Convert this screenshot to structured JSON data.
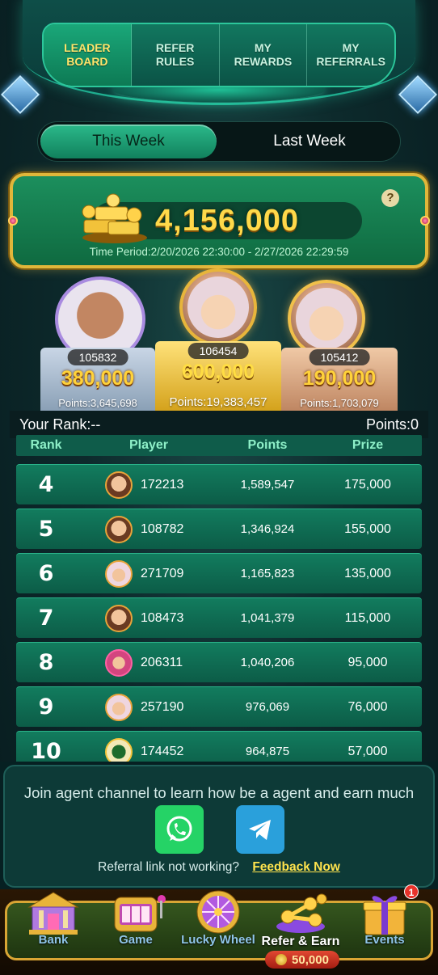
{
  "tabs": [
    {
      "label": "LEADER\nBOARD",
      "active": true
    },
    {
      "label": "REFER\nRULES",
      "active": false
    },
    {
      "label": "MY\nREWARDS",
      "active": false
    },
    {
      "label": "MY\nREFERRALS",
      "active": false
    }
  ],
  "week_toggle": {
    "this_week": "This Week",
    "last_week": "Last Week",
    "selected": "This Week"
  },
  "pool": {
    "amount": "4,156,000",
    "period": "Time Period:2/20/2026 22:30:00 - 2/27/2026 22:29:59",
    "help": "?"
  },
  "podium": {
    "first": {
      "id": "106454",
      "prize": "600,000",
      "points": "Points:19,383,457"
    },
    "second": {
      "id": "105832",
      "prize": "380,000",
      "points": "Points:3,645,698"
    },
    "third": {
      "id": "105412",
      "prize": "190,000",
      "points": "Points:1,703,079"
    }
  },
  "your_rank": {
    "label": "Your Rank:--",
    "points": "Points:0"
  },
  "table": {
    "headers": {
      "rank": "Rank",
      "player": "Player",
      "points": "Points",
      "prize": "Prize"
    },
    "rows": [
      {
        "rank": "4",
        "player": "172213",
        "points": "1,589,547",
        "prize": "175,000",
        "avatar": "boy"
      },
      {
        "rank": "5",
        "player": "108782",
        "points": "1,346,924",
        "prize": "155,000",
        "avatar": "boy"
      },
      {
        "rank": "6",
        "player": "271709",
        "points": "1,165,823",
        "prize": "135,000",
        "avatar": "hijab"
      },
      {
        "rank": "7",
        "player": "108473",
        "points": "1,041,379",
        "prize": "115,000",
        "avatar": "boy"
      },
      {
        "rank": "8",
        "player": "206311",
        "points": "1,040,206",
        "prize": "95,000",
        "avatar": "pink"
      },
      {
        "rank": "9",
        "player": "257190",
        "points": "976,069",
        "prize": "76,000",
        "avatar": "hijab"
      },
      {
        "rank": "10",
        "player": "174452",
        "points": "964,875",
        "prize": "57,000",
        "avatar": "dragon"
      }
    ]
  },
  "agent": {
    "text": "Join agent channel to learn how be a agent and earn much",
    "question": "Referral link not working?",
    "feedback": "Feedback Now"
  },
  "nav": [
    {
      "label": "Bank",
      "icon": "bank-icon"
    },
    {
      "label": "Game",
      "icon": "slot-machine-icon"
    },
    {
      "label": "Lucky Wheel",
      "icon": "wheel-icon"
    },
    {
      "label": "Refer & Earn",
      "icon": "refer-icon",
      "active": true
    },
    {
      "label": "Events",
      "icon": "gift-icon",
      "badge": "1"
    }
  ],
  "refer_coins": "50,000",
  "colors": {
    "accent_green": "#127c5e",
    "gold": "#ffd94a",
    "feedback_yellow": "#ffe34d"
  }
}
